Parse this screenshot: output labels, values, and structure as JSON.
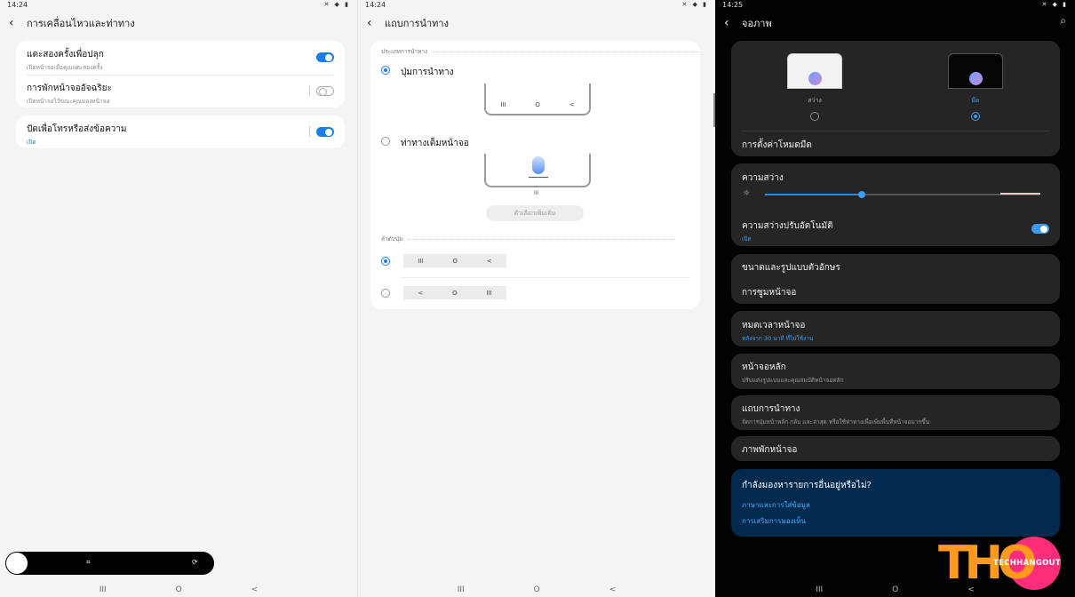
{
  "panel1": {
    "time": "14:24",
    "title": "การเคลื่อนไหวและท่าทาง",
    "items": [
      {
        "title": "แตะสองครั้งเพื่อปลุก",
        "subtitle": "เปิดหน้าจอเมื่อคุณแตะสองครั้ง",
        "on": true
      },
      {
        "title": "การพักหน้าจออัจฉริยะ",
        "subtitle": "เปิดหน้าจอไว้ขณะคุณมองหน้าจอ",
        "on": false
      },
      {
        "title": "ปัดเพื่อโทรหรือส่งข้อความ",
        "subtitle": "เปิด",
        "on": true
      }
    ]
  },
  "panel2": {
    "time": "14:24",
    "title": "แถบการนำทาง",
    "section_type": "ประเภทการนำทาง",
    "option_buttons": "ปุ่มการนำทาง",
    "option_gestures": "ท่าทางเต็มหน้าจอ",
    "more_options": "ตัวเลือกเพิ่มเติม",
    "section_order": "ลำดับปุ่ม",
    "nav_glyphs": {
      "recent": "III",
      "home": "O",
      "back": "<"
    }
  },
  "panel3": {
    "time": "14:25",
    "title": "จอภาพ",
    "theme_light": "สว่าง",
    "theme_dark": "มืด",
    "dark_settings": "การตั้งค่าโหมดมืด",
    "brightness": "ความสว่าง",
    "brightness_level": 0.35,
    "adaptive": "ความสว่างปรับอัตโนมัติ",
    "adaptive_status": "เปิด",
    "font": "ขนาดและรูปแบบตัวอักษร",
    "zoom": "การซูมหน้าจอ",
    "timeout": "หมดเวลาหน้าจอ",
    "timeout_sub": "หลังจาก 30 นาที ที่ไม่ใช้งาน",
    "home": "หน้าจอหลัก",
    "home_sub": "ปรับแต่งรูปแบบและคุณสมบัติหน้าจอหลัก",
    "navbar": "แถบการนำทาง",
    "navbar_sub": "จัดการปุ่มหน้าหลัก กลับ และล่าสุด หรือใช้ท่าทางเพื่อเพิ่มพื้นที่หน้าจอมากขึ้น",
    "saver": "ภาพพักหน้าจอ",
    "promo_q": "กำลังมองหารายการอื่นอยู่หรือไม่?",
    "promo_link1": "ภาษาและการใส่ข้อมูล",
    "promo_link2": "การเสริมการมองเห็น"
  },
  "logo": {
    "big": "THO",
    "small": "TECHHANGOUT"
  },
  "colors": {
    "accent": "#1a7ee8",
    "promo_bg": "#002a4e",
    "logo_orange": "#ff9a1e",
    "logo_pink": "#ff2d7a"
  }
}
